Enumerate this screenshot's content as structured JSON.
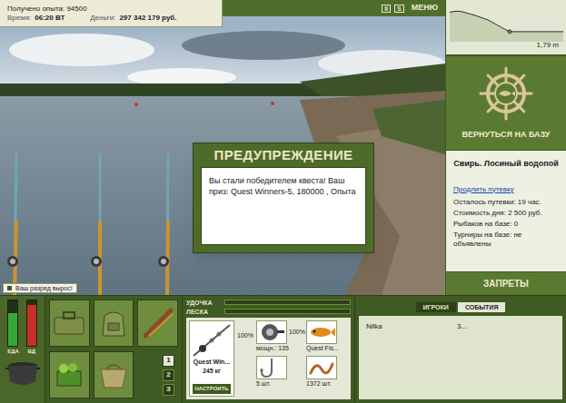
{
  "status": {
    "experience": "Получено опыта: 94500",
    "time_label": "Время:",
    "time": "06:20 ВТ",
    "money_label": "Деньги:",
    "money": "297 342 179 руб."
  },
  "toolbar": {
    "pause": "II",
    "sound": "S",
    "menu": "МЕНЮ"
  },
  "depth": {
    "reading": "1,79 m",
    "values": [
      0.55,
      0.5,
      0.48,
      0.52,
      0.6,
      0.68,
      0.75,
      0.85,
      0.95,
      1.05,
      1.2,
      1.35,
      1.5,
      1.65,
      1.79
    ]
  },
  "dialog": {
    "title": "ПРЕДУПРЕЖДЕНИЕ",
    "message": "Вы стали победителем квеста! Ваш приз: Quest Winners-5, 180000 , Опыта"
  },
  "toast": "Ваш разряд вырос!",
  "base": {
    "button": "ВЕРНУТЬСЯ НА БАЗУ",
    "location": "Свирь. Лосиный водопой",
    "extend_link": "Продлить путевку",
    "details": [
      "Осталось путевки: 19 час.",
      "Стоимость дня: 2 500 руб.",
      "Рыбаков на базе: 0",
      "Турниры на базе: не объявлены"
    ],
    "bans_button": "ЗАПРЕТЫ"
  },
  "needs": [
    {
      "name": "ЕДА",
      "level": 0.72,
      "color": "#36a83a"
    },
    {
      "name": "ВД",
      "level": 0.9,
      "color": "#c8302a"
    }
  ],
  "pages": [
    {
      "label": "1",
      "selected": true
    },
    {
      "label": "2",
      "selected": false
    },
    {
      "label": "3",
      "selected": false
    }
  ],
  "tension": [
    {
      "name": "УДОЧКА",
      "level": 0
    },
    {
      "name": "ЛЕСКА",
      "level": 0
    }
  ],
  "rod": {
    "name": "Quest Win...",
    "load": "245 кг",
    "setup": "НАСТРОИТЬ",
    "condition": "100%"
  },
  "tackle": [
    {
      "kind": "reel",
      "caption": "мощн.: 135",
      "condition": "100%"
    },
    {
      "kind": "lure",
      "caption": "Quest Fis..."
    },
    {
      "kind": "hook",
      "caption": "5 шт."
    },
    {
      "kind": "bait",
      "caption": "1372 шт."
    }
  ],
  "players": {
    "tabs": [
      {
        "label": "ИГРОКИ",
        "selected": false
      },
      {
        "label": "СОБЫТИЯ",
        "selected": true
      }
    ],
    "rows": [
      {
        "name": "Nilka",
        "value": "3..."
      }
    ]
  }
}
